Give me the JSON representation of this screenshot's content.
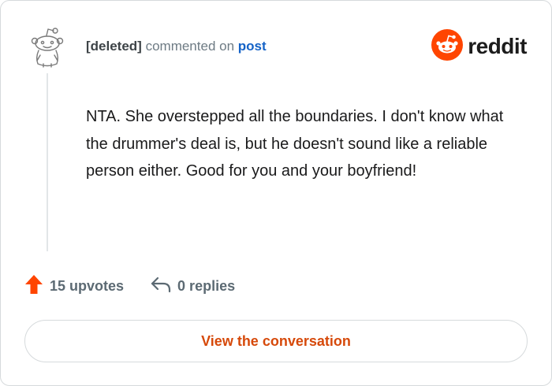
{
  "header": {
    "author": "[deleted]",
    "action_text": "commented on",
    "post_link": "post"
  },
  "brand": {
    "name": "reddit",
    "icon": "reddit-snoo-icon",
    "color": "#ff4500"
  },
  "comment": {
    "body": "NTA. She overstepped all the boundaries. I don't know what the drummer's deal is, but he doesn't sound like a reliable person either. Good for you and your boyfriend!"
  },
  "actions": {
    "upvotes_label": "15 upvotes",
    "upvote_icon": "upvote-arrow-icon",
    "replies_label": "0 replies",
    "reply_icon": "reply-arrow-icon"
  },
  "cta": {
    "label": "View the conversation"
  },
  "colors": {
    "accent": "#d6490a",
    "link": "#1563c7",
    "upvote": "#ff4500"
  }
}
